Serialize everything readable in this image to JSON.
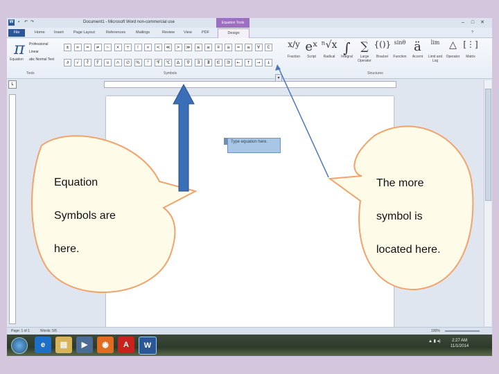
{
  "window": {
    "title": "Document1 - Microsoft Word non-commercial use",
    "contextual_tab_group": "Equation Tools",
    "app_icon": "W",
    "controls": [
      "–",
      "□",
      "✕"
    ]
  },
  "ribbon_tabs": [
    "File",
    "Home",
    "Insert",
    "Page Layout",
    "References",
    "Mailings",
    "Review",
    "View",
    "PDF",
    "Design"
  ],
  "tools_group": {
    "equation_label": "Equation",
    "options": [
      "Professional",
      "Linear",
      "abc Normal Text"
    ],
    "group_label": "Tools"
  },
  "symbols_group": {
    "group_label": "Symbols",
    "row1": [
      "±",
      "∞",
      "=",
      "≠",
      "~",
      "×",
      "÷",
      "!",
      "∝",
      "<",
      "≪",
      ">",
      "≫",
      "≤",
      "≥",
      "∓",
      "≅",
      "≈",
      "≡",
      "∀",
      "∁"
    ],
    "row2": [
      "∂",
      "√",
      "∛",
      "∜",
      "∪",
      "∩",
      "∅",
      "%",
      "°",
      "℉",
      "℃",
      "∆",
      "∇",
      "∃",
      "∄",
      "∈",
      "∋",
      "←",
      "↑",
      "→",
      "↓"
    ],
    "more_glyph": "▾"
  },
  "structures_group": {
    "group_label": "Structures",
    "items": [
      {
        "icon": "x/y",
        "label": "Fraction"
      },
      {
        "icon": "eˣ",
        "label": "Script"
      },
      {
        "icon": "ⁿ√x",
        "label": "Radical"
      },
      {
        "icon": "∫",
        "label": "Integral"
      },
      {
        "icon": "∑",
        "label": "Large Operator"
      },
      {
        "icon": "{()}",
        "label": "Bracket"
      },
      {
        "icon": "sinθ",
        "label": "Function"
      },
      {
        "icon": "ä",
        "label": "Accent"
      },
      {
        "icon": "lim",
        "label": "Limit and Log"
      },
      {
        "icon": "△",
        "label": "Operator"
      },
      {
        "icon": "[⋮]",
        "label": "Matrix"
      }
    ]
  },
  "document": {
    "equation_placeholder": "Type equation here."
  },
  "statusbar": {
    "page": "Page: 1 of 1",
    "words": "Words: 5/5",
    "zoom": "100%"
  },
  "taskbar": {
    "time": "2:27 AM",
    "date": "11/1/2014"
  },
  "callouts": {
    "left": {
      "line1": "Equation",
      "line2": "Symbols are",
      "line3": "here."
    },
    "right": {
      "line1": "The more",
      "line2": "symbol is",
      "line3": "located here."
    }
  },
  "colors": {
    "slide_background": "#d4c6dd",
    "callout_fill": "#fefbe8",
    "callout_stroke": "#f2a36b",
    "arrow_fill": "#3a6fb7",
    "word_blue": "#2b5797"
  }
}
